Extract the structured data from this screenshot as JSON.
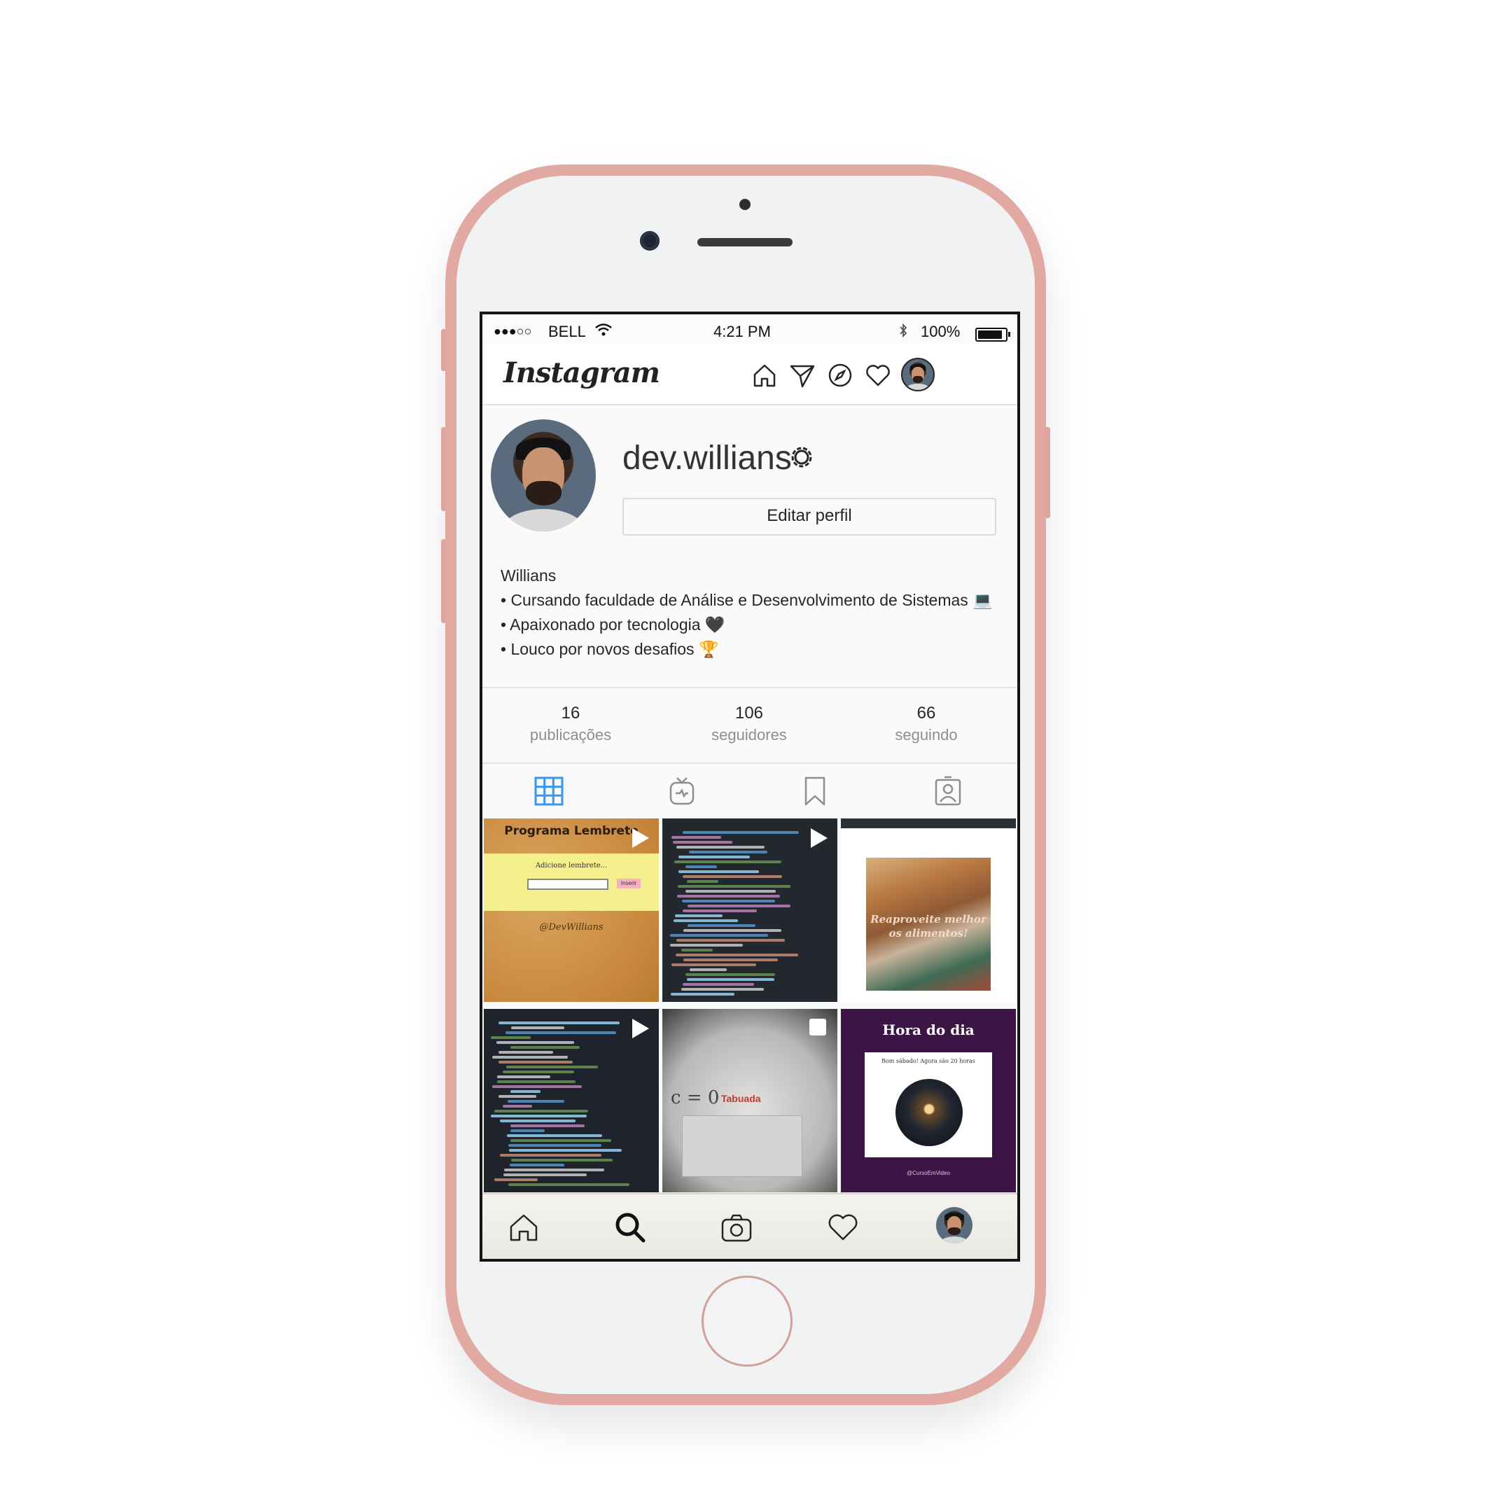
{
  "status_bar": {
    "signal_text": "●●●○○",
    "carrier": "BELL",
    "time": "4:21 PM",
    "battery": "100%",
    "battery_level": 1.0
  },
  "app": {
    "logo": "Instagram"
  },
  "profile": {
    "username": "dev.willians",
    "edit_button": "Editar perfil",
    "name": "Willians",
    "bio": [
      "• Cursando faculdade de Análise e Desenvolvimento de Sistemas 💻",
      "• Apaixonado por tecnologia 🖤",
      "• Louco por novos desafios 🏆"
    ]
  },
  "stats": [
    {
      "value": "16",
      "label": "publicações"
    },
    {
      "value": "106",
      "label": "seguidores"
    },
    {
      "value": "66",
      "label": "seguindo"
    }
  ],
  "posts": [
    {
      "type": "video",
      "title": "Programa Lembrete",
      "text": "Adicione lembrete...",
      "button": "Inserir",
      "footer": "@DevWillians",
      "theme": "cork"
    },
    {
      "type": "video",
      "theme": "code"
    },
    {
      "type": "video",
      "title": "Reaproveite melhor os alimentos!",
      "theme": "food"
    },
    {
      "type": "video",
      "theme": "code"
    },
    {
      "type": "album",
      "title": "Tabuada",
      "formula": "c = 0",
      "theme": "math"
    },
    {
      "type": "image",
      "title": "Hora do dia",
      "subtitle": "Bom sábado! Agora são 20 horas",
      "footer": "@CursoEmVideo",
      "theme": "purple"
    }
  ],
  "colors": {
    "phone_frame": "#e2a9a3",
    "active_tab": "#3897f0",
    "text_primary": "#262626",
    "text_secondary": "#8e8e8e"
  }
}
